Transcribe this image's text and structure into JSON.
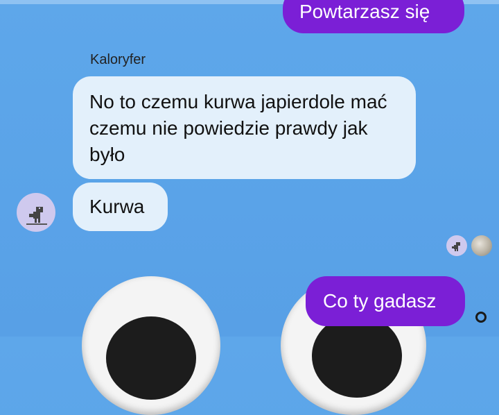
{
  "chat": {
    "sender_name": "Kaloryfer",
    "messages": [
      {
        "side": "outgoing",
        "text": "Powtarzasz się"
      },
      {
        "side": "incoming",
        "text": "No to czemu kurwa japierdole mać czemu nie powiedzie prawdy jak było"
      },
      {
        "side": "incoming",
        "text": "Kurwa"
      },
      {
        "side": "outgoing",
        "text": "Co ty gadasz"
      }
    ]
  },
  "colors": {
    "background": "#5aa3e8",
    "incoming_bubble": "#e3f0fb",
    "outgoing_bubble": "#7b1fd6"
  },
  "icons": {
    "sender_avatar": "dino-avatar",
    "read_receipt_1": "dino-avatar-small",
    "read_receipt_2": "photo-avatar-small",
    "status": "sent-status-ring"
  }
}
